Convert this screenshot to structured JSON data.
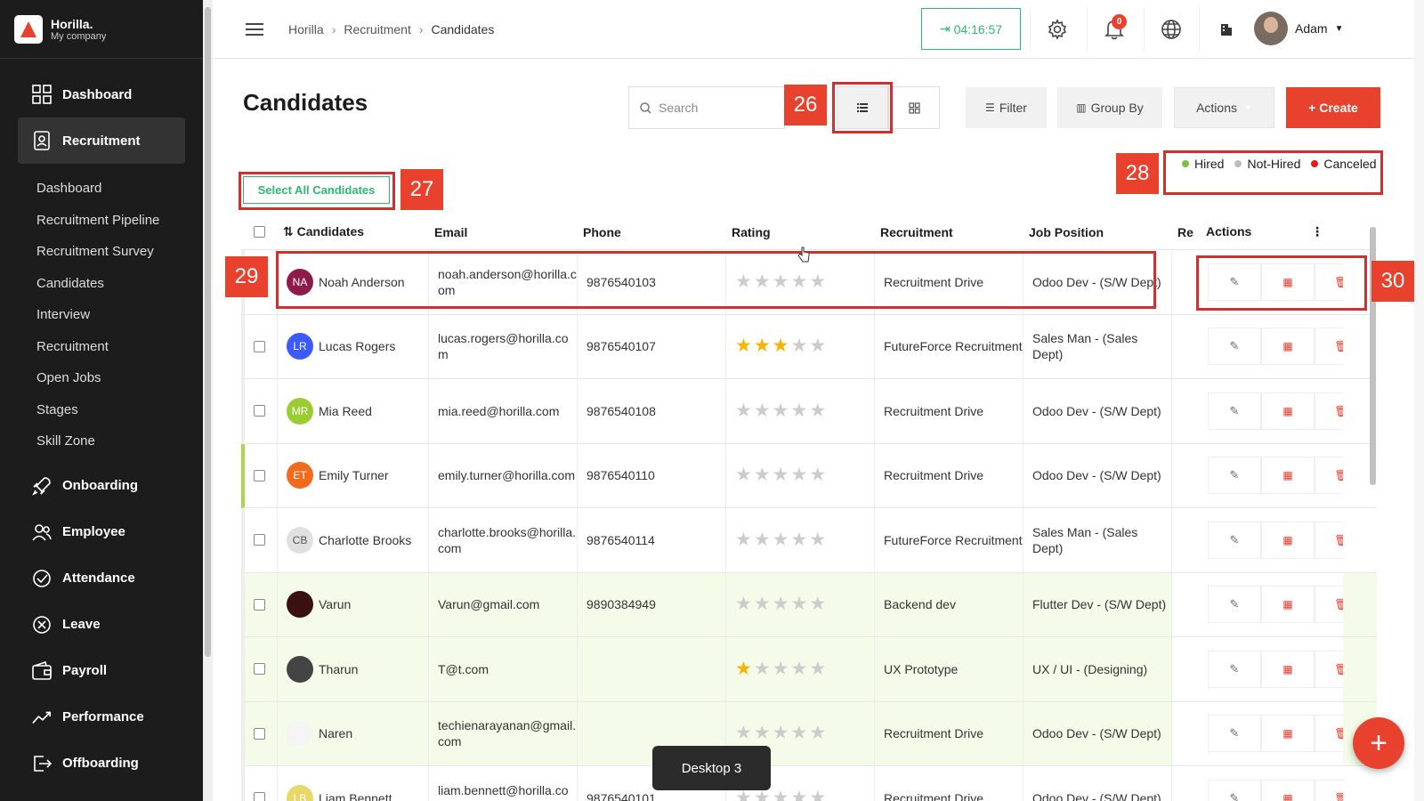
{
  "brand": {
    "name": "Horilla.",
    "company": "My company"
  },
  "sidebar": {
    "top": [
      {
        "label": "Dashboard",
        "icon": "dashboard-grid-icon"
      },
      {
        "label": "Recruitment",
        "icon": "recruitment-icon"
      }
    ],
    "sub": [
      "Dashboard",
      "Recruitment Pipeline",
      "Recruitment Survey",
      "Candidates",
      "Interview",
      "Recruitment",
      "Open Jobs",
      "Stages",
      "Skill Zone"
    ],
    "bottom": [
      {
        "label": "Onboarding",
        "icon": "rocket-icon"
      },
      {
        "label": "Employee",
        "icon": "people-icon"
      },
      {
        "label": "Attendance",
        "icon": "check-circle-icon"
      },
      {
        "label": "Leave",
        "icon": "x-circle-icon"
      },
      {
        "label": "Payroll",
        "icon": "wallet-icon"
      },
      {
        "label": "Performance",
        "icon": "trend-icon"
      },
      {
        "label": "Offboarding",
        "icon": "exit-icon"
      }
    ]
  },
  "header": {
    "breadcrumb": [
      "Horilla",
      "Recruitment",
      "Candidates"
    ],
    "timer": "04:16:57",
    "notifications": "0",
    "user": "Adam"
  },
  "page": {
    "title": "Candidates",
    "search_placeholder": "Search",
    "filter": "Filter",
    "group_by": "Group By",
    "actions": "Actions",
    "create": "+ Create",
    "select_all": "Select All Candidates"
  },
  "legend": [
    {
      "label": "Hired",
      "color": "#7bc043"
    },
    {
      "label": "Not-Hired",
      "color": "#bdbdbd"
    },
    {
      "label": "Canceled",
      "color": "#e31b1b"
    }
  ],
  "annotations": [
    "26",
    "27",
    "28",
    "29",
    "30"
  ],
  "table": {
    "headers": [
      "Candidates",
      "Email",
      "Phone",
      "Rating",
      "Recruitment",
      "Job Position",
      "Re",
      "Actions"
    ],
    "rows": [
      {
        "initials": "NA",
        "avatar_color": "#8e1b4a",
        "name": "Noah Anderson",
        "email": "noah.anderson@horilla.com",
        "phone": "9876540103",
        "rating": 0,
        "recruitment": "Recruitment Drive",
        "job": "Odoo Dev - (S/W Dept)",
        "green": false,
        "hl": false
      },
      {
        "initials": "LR",
        "avatar_color": "#3d5afe",
        "name": "Lucas Rogers",
        "email": "lucas.rogers@horilla.com",
        "phone": "9876540107",
        "rating": 3,
        "recruitment": "FutureForce Recruitment",
        "job": "Sales Man - (Sales Dept)",
        "green": false,
        "hl": false
      },
      {
        "initials": "MR",
        "avatar_color": "#9acd32",
        "name": "Mia Reed",
        "email": "mia.reed@horilla.com",
        "phone": "9876540108",
        "rating": 0,
        "recruitment": "Recruitment Drive",
        "job": "Odoo Dev - (S/W Dept)",
        "green": false,
        "hl": false
      },
      {
        "initials": "ET",
        "avatar_color": "#f26b1d",
        "name": "Emily Turner",
        "email": "emily.turner@horilla.com",
        "phone": "9876540110",
        "rating": 0,
        "recruitment": "Recruitment Drive",
        "job": "Odoo Dev - (S/W Dept)",
        "green": false,
        "hl": true
      },
      {
        "initials": "CB",
        "avatar_color": "#e0e0e0",
        "name": "Charlotte Brooks",
        "email": "charlotte.brooks@horilla.com",
        "phone": "9876540114",
        "rating": 0,
        "recruitment": "FutureForce Recruitment",
        "job": "Sales Man - (Sales Dept)",
        "green": false,
        "hl": false
      },
      {
        "initials": "",
        "avatar_color": "#3a1010",
        "name": "Varun",
        "email": "Varun@gmail.com",
        "phone": "9890384949",
        "rating": 0,
        "recruitment": "Backend dev",
        "job": "Flutter Dev - (S/W Dept)",
        "green": true,
        "hl": false
      },
      {
        "initials": "",
        "avatar_color": "#444444",
        "name": "Tharun",
        "email": "T@t.com",
        "phone": "",
        "rating": 1,
        "recruitment": "UX Prototype",
        "job": "UX / UI - (Designing)",
        "green": true,
        "hl": false
      },
      {
        "initials": "",
        "avatar_color": "#f5f5f5",
        "name": "Naren",
        "email": "techienarayanan@gmail.com",
        "phone": "",
        "rating": 0,
        "recruitment": "Recruitment Drive",
        "job": "Odoo Dev - (S/W Dept)",
        "green": true,
        "hl": false
      },
      {
        "initials": "LB",
        "avatar_color": "#e6d96a",
        "name": "Liam Bennett",
        "email": "liam.bennett@horilla.com",
        "phone": "9876540101",
        "rating": 0,
        "recruitment": "Recruitment Drive",
        "job": "Odoo Dev - (S/W Dept)",
        "green": false,
        "hl": false
      }
    ]
  },
  "toast": "Desktop 3"
}
